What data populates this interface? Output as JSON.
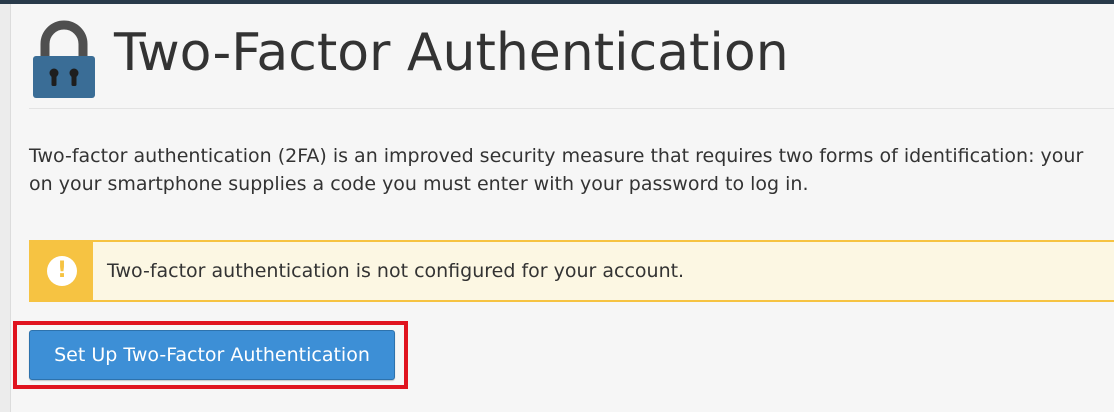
{
  "page": {
    "title": "Two-Factor Authentication",
    "title_icon": "lock-icon"
  },
  "description": {
    "line1": "Two-factor authentication (2FA) is an improved security measure that requires two forms of identification: your",
    "line2": "on your smartphone supplies a code you must enter with your password to log in."
  },
  "alert": {
    "type": "warning",
    "icon": "exclamation-icon",
    "icon_symbol": "!",
    "message": "Two-factor authentication is not configured for your account."
  },
  "actions": {
    "setup_label": "Set Up Two-Factor Authentication"
  },
  "colors": {
    "primary_button": "#3d8fd6",
    "warning": "#f6c342",
    "warning_background": "#fcf7e3",
    "highlight": "#e0141f",
    "lock_icon": "#3a6d96"
  }
}
